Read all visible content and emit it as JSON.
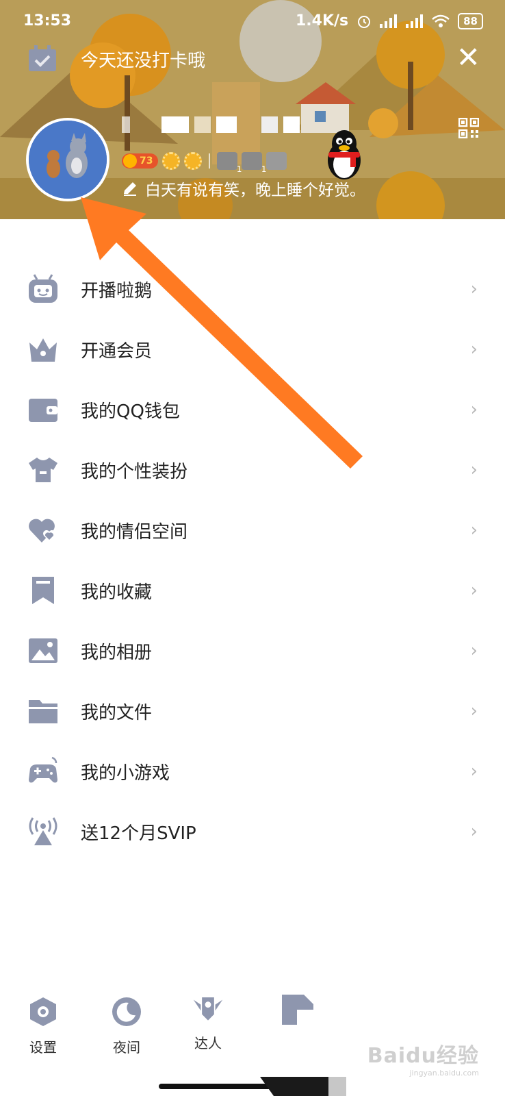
{
  "status_bar": {
    "time": "13:53",
    "network_speed": "1.4K/s",
    "battery": "88"
  },
  "header": {
    "checkin_text": "今天还没打卡哦",
    "close_symbol": "✕",
    "coin_value": "73",
    "signature": "白天有说有笑，晚上睡个好觉。",
    "mini_badge_counts": [
      "1",
      "1"
    ]
  },
  "menu": {
    "items": [
      {
        "label": "开播啦鹅",
        "icon": "tv-robot-icon"
      },
      {
        "label": "开通会员",
        "icon": "crown-icon"
      },
      {
        "label": "我的QQ钱包",
        "icon": "wallet-icon"
      },
      {
        "label": "我的个性装扮",
        "icon": "tshirt-icon"
      },
      {
        "label": "我的情侣空间",
        "icon": "hearts-icon"
      },
      {
        "label": "我的收藏",
        "icon": "bookmark-icon"
      },
      {
        "label": "我的相册",
        "icon": "photo-icon"
      },
      {
        "label": "我的文件",
        "icon": "folder-icon"
      },
      {
        "label": "我的小游戏",
        "icon": "gamepad-icon"
      },
      {
        "label": "送12个月SVIP",
        "icon": "broadcast-icon"
      }
    ],
    "chevron": "›"
  },
  "bottom_bar": {
    "settings_label": "设置",
    "night_label": "夜间",
    "expert_label": "达人"
  },
  "watermark": {
    "text": "Baidu经验",
    "url": "jingyan.baidu.com"
  },
  "colors": {
    "accent_arrow": "#ff7a22",
    "icon_gray": "#8e96ae",
    "header_bg": "#b39a55"
  }
}
